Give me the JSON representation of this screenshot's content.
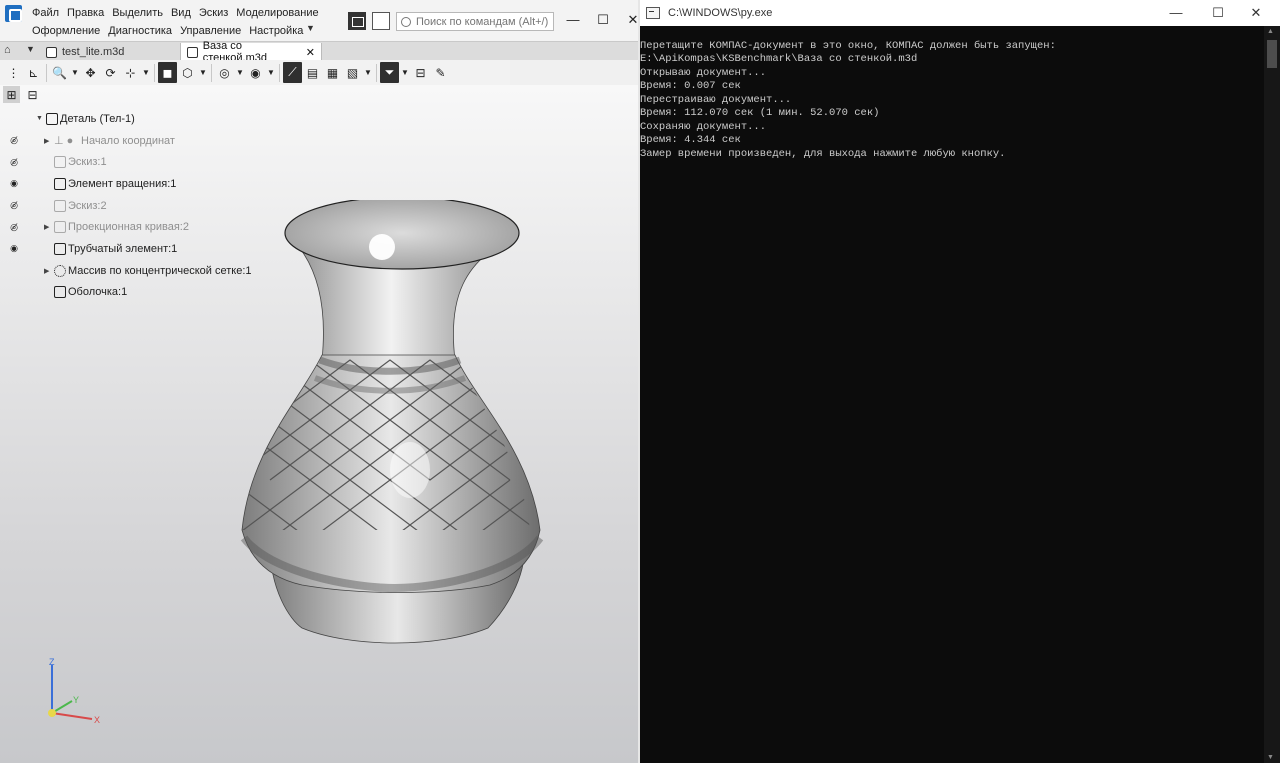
{
  "kompas": {
    "menu_row1": [
      "Файл",
      "Правка",
      "Выделить",
      "Вид",
      "Эскиз",
      "Моделирование"
    ],
    "menu_row2": [
      "Оформление",
      "Диагностика",
      "Управление",
      "Настройка"
    ],
    "search_placeholder": "Поиск по командам (Alt+/)",
    "window_controls": {
      "minimize": "—",
      "maximize": "☐",
      "close": "✕"
    },
    "tabs": [
      {
        "label": "test_lite.m3d"
      },
      {
        "label": "Ваза со стенкой.m3d",
        "close": "✕"
      }
    ],
    "tree": {
      "root": "Деталь (Тел-1)",
      "items": [
        {
          "label": "Начало координат",
          "visible": false,
          "expandable": true,
          "grayed": true
        },
        {
          "label": "Эскиз:1",
          "visible": false,
          "expandable": false,
          "grayed": true
        },
        {
          "label": "Элемент вращения:1",
          "visible": true,
          "expandable": false,
          "grayed": false
        },
        {
          "label": "Эскиз:2",
          "visible": false,
          "expandable": false,
          "grayed": true
        },
        {
          "label": "Проекционная кривая:2",
          "visible": false,
          "expandable": true,
          "grayed": true
        },
        {
          "label": "Трубчатый элемент:1",
          "visible": true,
          "expandable": false,
          "grayed": false
        },
        {
          "label": "Массив по концентрической сетке:1",
          "visible": false,
          "expandable": true,
          "grayed": false
        },
        {
          "label": "Оболочка:1",
          "visible": false,
          "expandable": false,
          "grayed": false
        }
      ]
    },
    "triad_axes": {
      "z": "Z",
      "y": "Y",
      "x": "X"
    }
  },
  "console": {
    "title": "C:\\WINDOWS\\py.exe",
    "lines": [
      "Перетащите КОМПАС-документ в это окно, КОМПАС должен быть запущен:",
      "E:\\ApiKompas\\KSBenchmark\\Ваза со стенкой.m3d",
      "Открываю документ...",
      "Время: 0.007 сек",
      "Перестраиваю документ...",
      "Время: 112.070 сек (1 мин. 52.070 сек)",
      "Сохраняю документ...",
      "Время: 4.344 сек",
      "Замер времени произведен, для выхода нажмите любую кнопку."
    ],
    "window_controls": {
      "minimize": "—",
      "maximize": "☐",
      "close": "✕"
    }
  }
}
